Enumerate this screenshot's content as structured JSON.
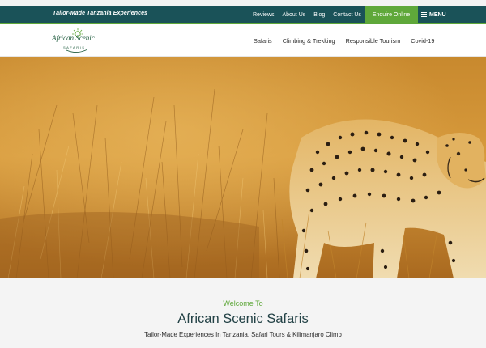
{
  "topbar": {
    "tagline": "Tailor-Made Tanzania Experiences",
    "links": [
      "Reviews",
      "About Us",
      "Blog",
      "Contact Us"
    ],
    "enquire_label": "Enquire Online",
    "menu_label": "MENU"
  },
  "header": {
    "logo_text": "African Scenic",
    "logo_sub": "SAFARIS",
    "nav": [
      "Safaris",
      "Climbing & Trekking",
      "Responsible Tourism",
      "Covid-19"
    ]
  },
  "hero": {
    "image_subject": "cheetah walking through golden savanna grass"
  },
  "welcome": {
    "kicker": "Welcome To",
    "title": "African Scenic Safaris",
    "subtitle": "Tailor-Made Experiences In Tanzania, Safari Tours & Kilimanjaro Climb"
  },
  "colors": {
    "topbar_bg": "#1a5258",
    "accent_green": "#5fa83a",
    "title_color": "#234246"
  }
}
